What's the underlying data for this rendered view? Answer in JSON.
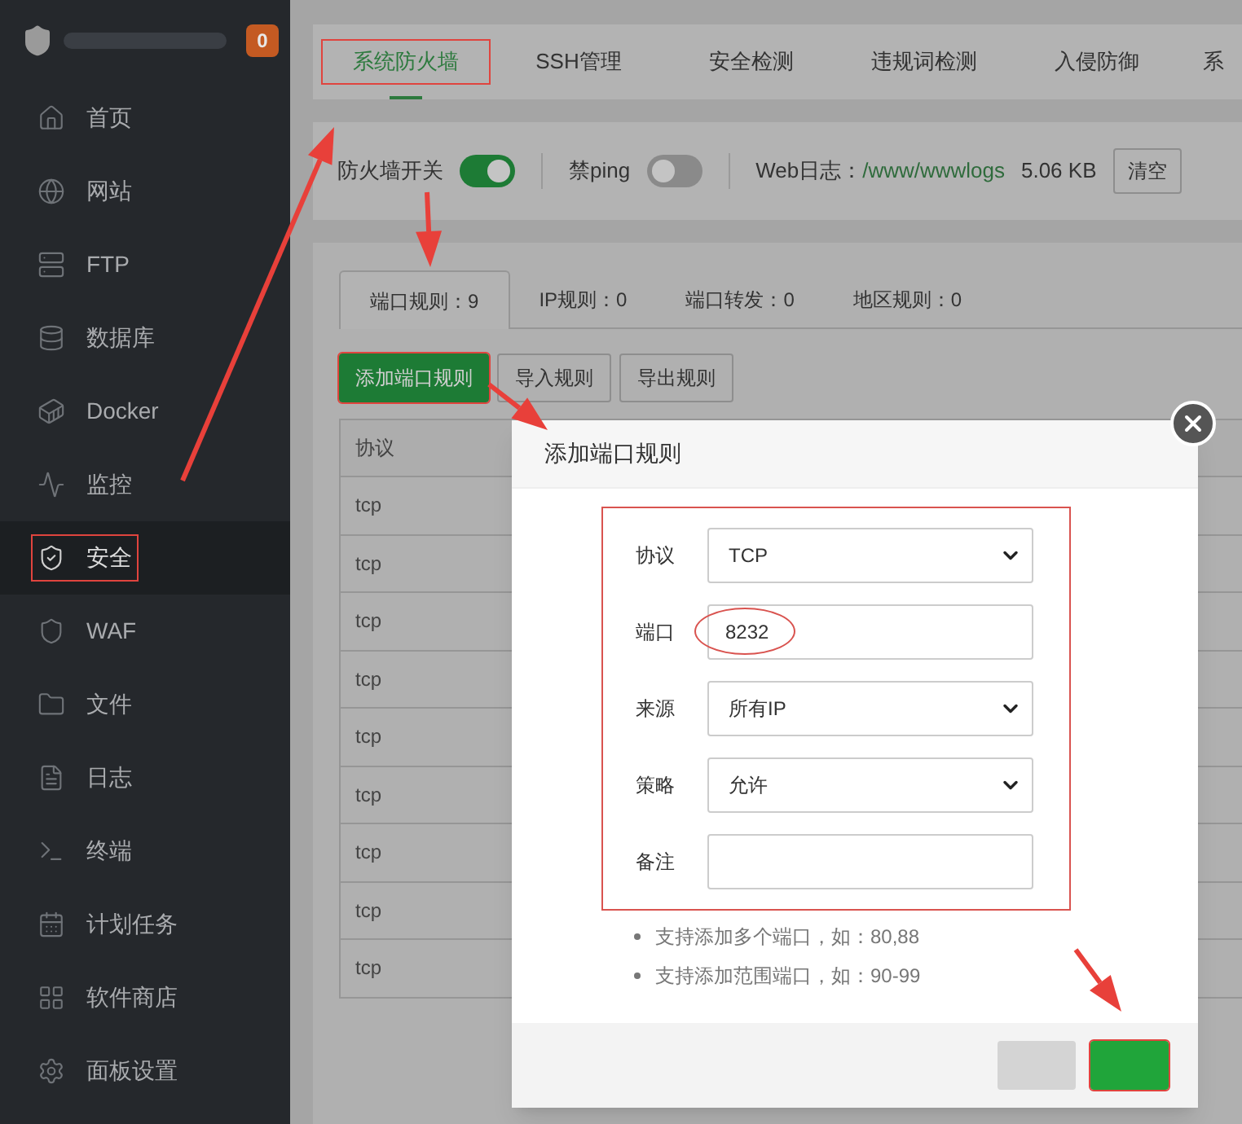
{
  "sidebar": {
    "badge": "0",
    "items": [
      {
        "label": "首页",
        "selected": false,
        "highlighted": false
      },
      {
        "label": "网站",
        "selected": false,
        "highlighted": false
      },
      {
        "label": "FTP",
        "selected": false,
        "highlighted": false
      },
      {
        "label": "数据库",
        "selected": false,
        "highlighted": false
      },
      {
        "label": "Docker",
        "selected": false,
        "highlighted": false
      },
      {
        "label": "监控",
        "selected": false,
        "highlighted": false
      },
      {
        "label": "安全",
        "selected": true,
        "highlighted": true
      },
      {
        "label": "WAF",
        "selected": false,
        "highlighted": false
      },
      {
        "label": "文件",
        "selected": false,
        "highlighted": false
      },
      {
        "label": "日志",
        "selected": false,
        "highlighted": false
      },
      {
        "label": "终端",
        "selected": false,
        "highlighted": false
      },
      {
        "label": "计划任务",
        "selected": false,
        "highlighted": false
      },
      {
        "label": "软件商店",
        "selected": false,
        "highlighted": false
      },
      {
        "label": "面板设置",
        "selected": false,
        "highlighted": false
      }
    ]
  },
  "tabs": [
    {
      "label": "系统防火墙",
      "selected": true,
      "highlighted": true
    },
    {
      "label": "SSH管理",
      "selected": false,
      "highlighted": false
    },
    {
      "label": "安全检测",
      "selected": false,
      "highlighted": false
    },
    {
      "label": "违规词检测",
      "selected": false,
      "highlighted": false
    },
    {
      "label": "入侵防御",
      "selected": false,
      "highlighted": false
    },
    {
      "label": "系",
      "selected": false,
      "highlighted": false
    }
  ],
  "switches": [
    {
      "label": "防火墙开关",
      "on": true
    },
    {
      "label": "禁ping",
      "on": false
    }
  ],
  "web_log": {
    "label": "Web日志：",
    "path": "/www/wwwlogs",
    "size": "5.06 KB",
    "clear_button": "清空"
  },
  "rule_tabs": [
    {
      "label": "端口规则：9",
      "selected": true
    },
    {
      "label": "IP规则：0",
      "selected": false
    },
    {
      "label": "端口转发：0",
      "selected": false
    },
    {
      "label": "地区规则：0",
      "selected": false
    }
  ],
  "actions": [
    {
      "label": "添加端口规则",
      "kind": "primary",
      "highlighted": true
    },
    {
      "label": "导入规则",
      "kind": "default",
      "highlighted": false
    },
    {
      "label": "导出规则",
      "kind": "default",
      "highlighted": false
    }
  ],
  "table": {
    "columns": [
      "协议"
    ],
    "rows": [
      [
        "tcp"
      ],
      [
        "tcp"
      ],
      [
        "tcp"
      ],
      [
        "tcp"
      ],
      [
        "tcp"
      ],
      [
        "tcp"
      ],
      [
        "tcp"
      ],
      [
        "tcp"
      ],
      [
        "tcp"
      ]
    ]
  },
  "dialog": {
    "title": "添加端口规则",
    "fields": [
      {
        "label": "协议",
        "kind": "select",
        "value": "TCP",
        "circled": false
      },
      {
        "label": "端口",
        "kind": "input",
        "value": "8232",
        "circled": true
      },
      {
        "label": "来源",
        "kind": "select",
        "value": "所有IP",
        "circled": false
      },
      {
        "label": "策略",
        "kind": "select",
        "value": "允许",
        "circled": false
      },
      {
        "label": "备注",
        "kind": "input",
        "circled": false
      }
    ],
    "notes": [
      "支持添加多个端口，如：80,88",
      "支持添加范围端口，如：90-99"
    ],
    "buttons": [
      {
        "kind": "cancel",
        "highlighted": false
      },
      {
        "kind": "confirm",
        "highlighted": true
      }
    ]
  }
}
